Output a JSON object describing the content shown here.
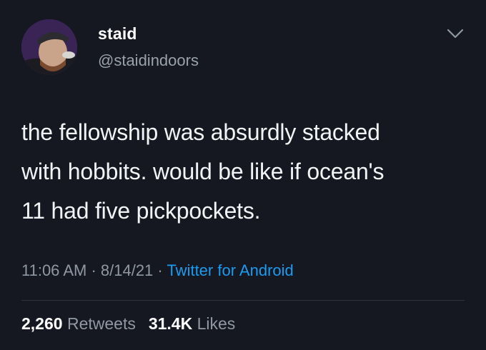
{
  "author": {
    "display_name": "staid",
    "handle": "@staidindoors"
  },
  "tweet": {
    "line1": "the fellowship was absurdly stacked",
    "line2": "with hobbits. would be like if ocean's",
    "line3": "11 had five pickpockets."
  },
  "meta": {
    "time": "11:06 AM",
    "sep1": " · ",
    "date": "8/14/21",
    "sep2": " · ",
    "source": "Twitter for Android"
  },
  "stats": {
    "retweets_count": "2,260",
    "retweets_label": "Retweets",
    "likes_count": "31.4K",
    "likes_label": "Likes"
  },
  "icons": {
    "more": "chevron-down-icon",
    "avatar": "avatar"
  },
  "colors": {
    "background": "#151820",
    "link": "#1d9bf0",
    "muted": "#8f98a3"
  }
}
